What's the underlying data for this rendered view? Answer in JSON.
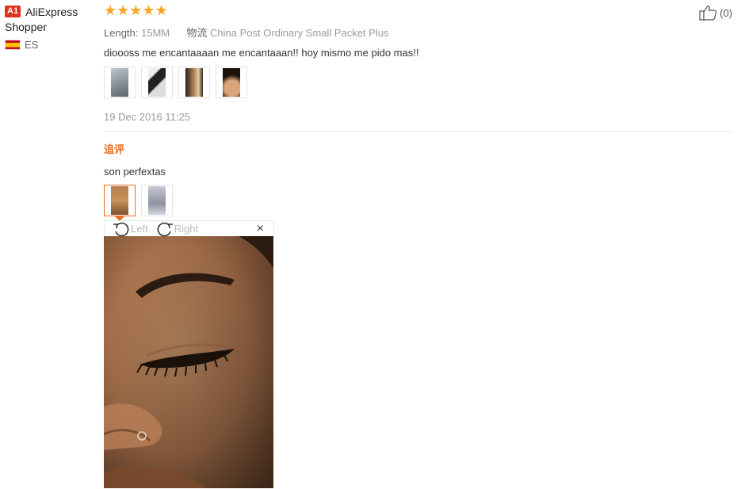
{
  "user": {
    "badge": "A1",
    "name_line1": "AliExpress",
    "name_line2": "Shopper",
    "country_code": "ES"
  },
  "helpful": {
    "count": "(0)",
    "icon": "thumbs-up-icon"
  },
  "review": {
    "rating": 5,
    "stars": "★★★★★",
    "length_label": "Length:",
    "length_value": "15MM",
    "shipping_label": "物流",
    "shipping_value": "China Post Ordinary Small Packet Plus",
    "text": "dioooss me encantaaaan me encantaaan!! hoy mismo me pido mas!!",
    "date": "19 Dec 2016 11:25"
  },
  "followup": {
    "title": "追评",
    "text": "son perfextas"
  },
  "viewer": {
    "rotate_left": "Left",
    "rotate_right": "Right",
    "close": "×"
  },
  "colors": {
    "accent": "#e86d1f",
    "star": "#f5a623",
    "badge": "#e0301e"
  }
}
